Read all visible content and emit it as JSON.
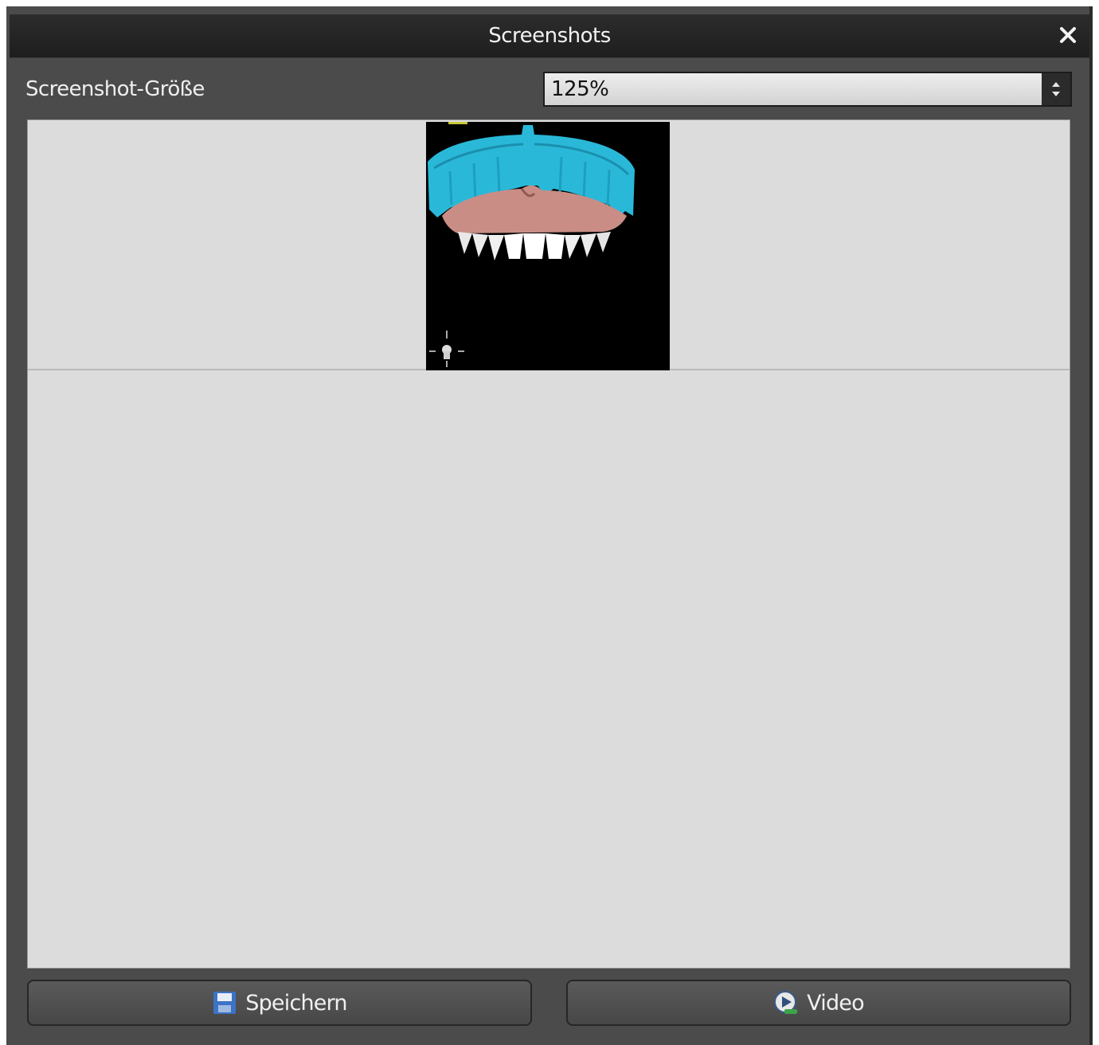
{
  "dialog": {
    "title": "Screenshots",
    "close_icon": "close-icon"
  },
  "size_row": {
    "label": "Screenshot-Größe",
    "selected_value": "125%",
    "spinner_icon": "up-down-arrows-icon"
  },
  "gallery": {
    "thumbnails": [
      {
        "description_icon": "dental-model-thumbnail"
      }
    ]
  },
  "buttons": {
    "save_label": "Speichern",
    "save_icon": "floppy-disk-icon",
    "video_label": "Video",
    "video_icon": "video-play-icon"
  },
  "colors": {
    "titlebar": "#1e1e1e",
    "panel": "#4b4b4b",
    "canvas": "#dcdcdc",
    "guide_blue": "#2ab8d8",
    "gum_pink": "#c98d86"
  }
}
